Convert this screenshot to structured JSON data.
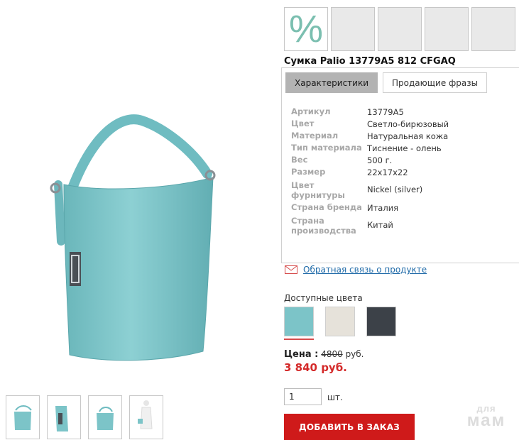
{
  "product": {
    "title": "Сумка Palio 13779A5 812 CFGAQ"
  },
  "badges": {
    "discount_symbol": "%"
  },
  "tabs": [
    {
      "label": "Характеристики",
      "active": true
    },
    {
      "label": "Продающие фразы",
      "active": false
    }
  ],
  "specs": [
    {
      "key": "Артикул",
      "value": "13779A5"
    },
    {
      "key": "Цвет",
      "value": "Светло-бирюзовый"
    },
    {
      "key": "Материал",
      "value": "Натуральная кожа"
    },
    {
      "key": "Тип материала",
      "value": "Тиснение - олень"
    },
    {
      "key": "Вес",
      "value": "500 г."
    },
    {
      "key": "Размер",
      "value": "22x17x22"
    },
    {
      "key": "Цвет фурнитуры",
      "value": "Nickel (silver)"
    },
    {
      "key": "Страна бренда",
      "value": "Италия"
    },
    {
      "key": "Страна производства",
      "value": "Китай"
    }
  ],
  "feedback": {
    "link_text": "Обратная связь о продукте"
  },
  "colors": {
    "title": "Доступные цвета",
    "swatches": [
      "#7cc4c8",
      "#e6e2da",
      "#3c4148"
    ]
  },
  "price": {
    "label": "Цена :",
    "old": "4800",
    "old_currency": "руб.",
    "new": "3 840 руб."
  },
  "order": {
    "quantity": "1",
    "unit": "шт.",
    "add_label": "ДОБАВИТЬ В ЗАКАЗ"
  },
  "watermark": {
    "top": "для",
    "bottom": "мам"
  },
  "theme": {
    "accent": "#cf1a1a",
    "bag_color": "#7cc4c8"
  }
}
